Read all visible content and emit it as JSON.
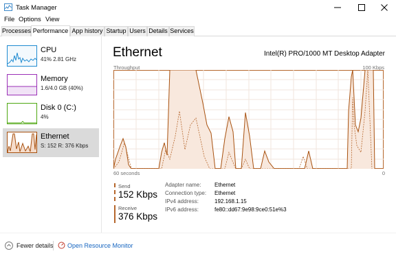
{
  "window": {
    "title": "Task Manager",
    "minimize_icon": "minimize-icon",
    "maximize_icon": "maximize-icon",
    "close_icon": "close-icon"
  },
  "menu": [
    "File",
    "Options",
    "View"
  ],
  "tabs": [
    "Processes",
    "Performance",
    "App history",
    "Startup",
    "Users",
    "Details",
    "Services"
  ],
  "active_tab": "Performance",
  "sidebar": [
    {
      "label": "CPU",
      "sub": "41%  2.81 GHz",
      "color": "#1e8ad0"
    },
    {
      "label": "Memory",
      "sub": "1.6/4.0 GB (40%)",
      "color": "#9a2fb6"
    },
    {
      "label": "Disk 0 (C:)",
      "sub": "4%",
      "color": "#4da60f"
    },
    {
      "label": "Ethernet",
      "sub": "S: 152  R: 376 Kbps",
      "color": "#a7500e"
    }
  ],
  "detail": {
    "title": "Ethernet",
    "adapter": "Intel(R) PRO/1000 MT Desktop Adapter",
    "graph_caption_left": "Throughput",
    "graph_caption_right": "100 Kbps",
    "axis_left": "60 seconds",
    "axis_right": "0",
    "send_label": "Send",
    "send_value": "152 Kbps",
    "receive_label": "Receive",
    "receive_value": "376 Kbps",
    "info": [
      {
        "label": "Adapter name:",
        "value": "Ethernet"
      },
      {
        "label": "Connection type:",
        "value": "Ethernet"
      },
      {
        "label": "IPv4 address:",
        "value": "192.168.1.15"
      },
      {
        "label": "IPv6 address:",
        "value": "fe80::dd67:9e98:9ce0:51e%3"
      }
    ],
    "accent": "#b5652a"
  },
  "footer": {
    "fewer_details": "Fewer details",
    "open_monitor": "Open Resource Monitor"
  }
}
